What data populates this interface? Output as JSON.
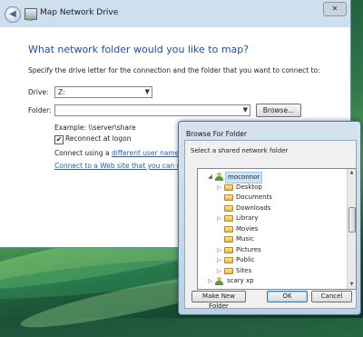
{
  "window": {
    "title": "Map Network Drive",
    "close_glyph": "✕",
    "back_glyph": "◀"
  },
  "main": {
    "heading": "What network folder would you like to map?",
    "instructions": "Specify the drive letter for the connection and the folder that you want to connect to:",
    "drive_label": "Drive:",
    "drive_value": "Z:",
    "folder_label": "Folder:",
    "folder_value": "",
    "browse_label": "Browse...",
    "example": "Example: \\\\server\\share",
    "reconnect_label": "Reconnect at logon",
    "reconnect_checked": true,
    "connect_using_prefix": "Connect using a ",
    "connect_using_link": "different user name",
    "connect_using_suffix": ".",
    "web_link": "Connect to a Web site that you can use to"
  },
  "browse_dialog": {
    "title": "Browse For Folder",
    "subtitle": "Select a shared network folder",
    "tree": [
      {
        "name": "moconnor",
        "type": "user",
        "expanded": true,
        "selected": true,
        "depth": 0
      },
      {
        "name": "Desktop",
        "type": "folder",
        "expandable": true,
        "depth": 1
      },
      {
        "name": "Documents",
        "type": "folder",
        "expandable": false,
        "depth": 1
      },
      {
        "name": "Downloads",
        "type": "folder",
        "expandable": false,
        "depth": 1
      },
      {
        "name": "Library",
        "type": "folder",
        "expandable": true,
        "depth": 1
      },
      {
        "name": "Movies",
        "type": "folder",
        "expandable": false,
        "depth": 1
      },
      {
        "name": "Music",
        "type": "folder",
        "expandable": false,
        "depth": 1
      },
      {
        "name": "Pictures",
        "type": "folder",
        "expandable": true,
        "depth": 1
      },
      {
        "name": "Public",
        "type": "folder",
        "expandable": true,
        "depth": 1
      },
      {
        "name": "Sites",
        "type": "folder",
        "expandable": true,
        "depth": 1
      },
      {
        "name": "scary xp",
        "type": "user",
        "expandable": true,
        "depth": 0
      }
    ],
    "make_new_folder_label": "Make New Folder",
    "ok_label": "OK",
    "cancel_label": "Cancel"
  },
  "colors": {
    "heading": "#1e4fa3",
    "link": "#1f5fb8",
    "selection": "#cce4f7"
  }
}
